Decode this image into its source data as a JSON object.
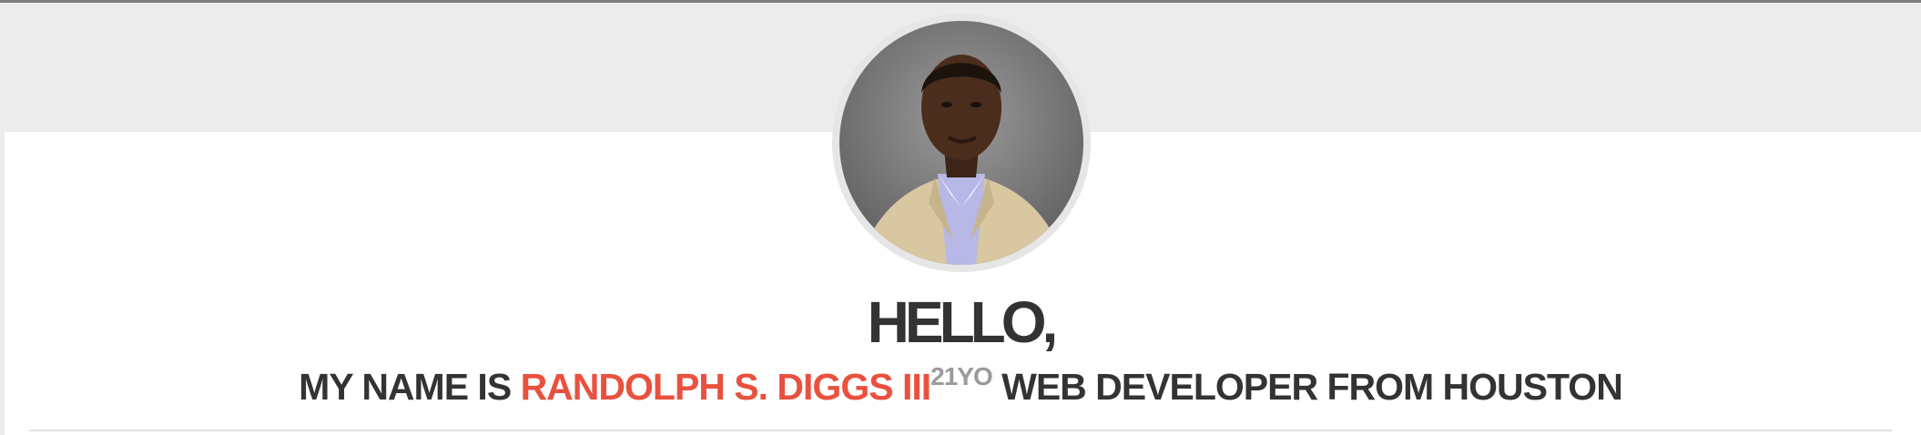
{
  "hero": {
    "greeting": "HELLO,",
    "intro_prefix": "MY NAME IS",
    "name": "RANDOLPH S. DIGGS III",
    "age": "21YO",
    "intro_suffix": "WEB DEVELOPER FROM HOUSTON"
  },
  "colors": {
    "accent": "#e9513f",
    "text": "#333333",
    "muted": "#9a9a9a",
    "band": "#ececec"
  },
  "icons": {
    "avatar": "profile-photo"
  }
}
